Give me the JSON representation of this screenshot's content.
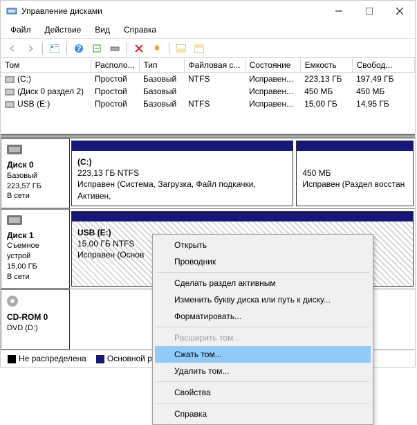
{
  "window": {
    "title": "Управление дисками"
  },
  "menu": [
    "Файл",
    "Действие",
    "Вид",
    "Справка"
  ],
  "columns": [
    "Том",
    "Располо...",
    "Тип",
    "Файловая с...",
    "Состояние",
    "Емкость",
    "Свобод..."
  ],
  "volumes": [
    {
      "name": "(C:)",
      "layout": "Простой",
      "type": "Базовый",
      "fs": "NTFS",
      "status": "Исправен...",
      "capacity": "223,13 ГБ",
      "free": "197,49 ГБ"
    },
    {
      "name": "(Диск 0 раздел 2)",
      "layout": "Простой",
      "type": "Базовый",
      "fs": "",
      "status": "Исправен...",
      "capacity": "450 МБ",
      "free": "450 МБ"
    },
    {
      "name": "USB (E:)",
      "layout": "Простой",
      "type": "Базовый",
      "fs": "NTFS",
      "status": "Исправен...",
      "capacity": "15,00 ГБ",
      "free": "14,95 ГБ"
    }
  ],
  "disks": [
    {
      "name": "Диск 0",
      "kind": "Базовый",
      "size": "223,57 ГБ",
      "status": "В сети",
      "parts": [
        {
          "flex": 3,
          "title": "(C:)",
          "line2": "223,13 ГБ NTFS",
          "line3": "Исправен (Система, Загрузка, Файл подкачки, Активен,",
          "primary": true,
          "hatched": false
        },
        {
          "flex": 1.5,
          "title": "",
          "line2": "450 МБ",
          "line3": "Исправен (Раздел восстан",
          "primary": true,
          "hatched": false
        }
      ]
    },
    {
      "name": "Диск 1",
      "kind": "Съемное устрой",
      "size": "15,00 ГБ",
      "status": "В сети",
      "parts": [
        {
          "flex": 1,
          "title": "USB  (E:)",
          "line2": "15,00 ГБ NTFS",
          "line3": "Исправен (Основ",
          "primary": true,
          "hatched": true
        }
      ]
    },
    {
      "name": "CD-ROM 0",
      "kind": "DVD (D:)",
      "size": "",
      "status": "",
      "cd": true,
      "parts": []
    }
  ],
  "legend": {
    "a": "Не распределена",
    "b": "Основной р"
  },
  "context": {
    "items": [
      {
        "label": "Открыть",
        "state": ""
      },
      {
        "label": "Проводник",
        "state": ""
      },
      {
        "sep": true
      },
      {
        "label": "Сделать раздел активным",
        "state": ""
      },
      {
        "label": "Изменить букву диска или путь к диску...",
        "state": ""
      },
      {
        "label": "Форматировать...",
        "state": ""
      },
      {
        "sep": true
      },
      {
        "label": "Расширить том...",
        "state": "disabled"
      },
      {
        "label": "Сжать том...",
        "state": "hover"
      },
      {
        "label": "Удалить том...",
        "state": ""
      },
      {
        "sep": true
      },
      {
        "label": "Свойства",
        "state": ""
      },
      {
        "sep": true
      },
      {
        "label": "Справка",
        "state": ""
      }
    ]
  }
}
